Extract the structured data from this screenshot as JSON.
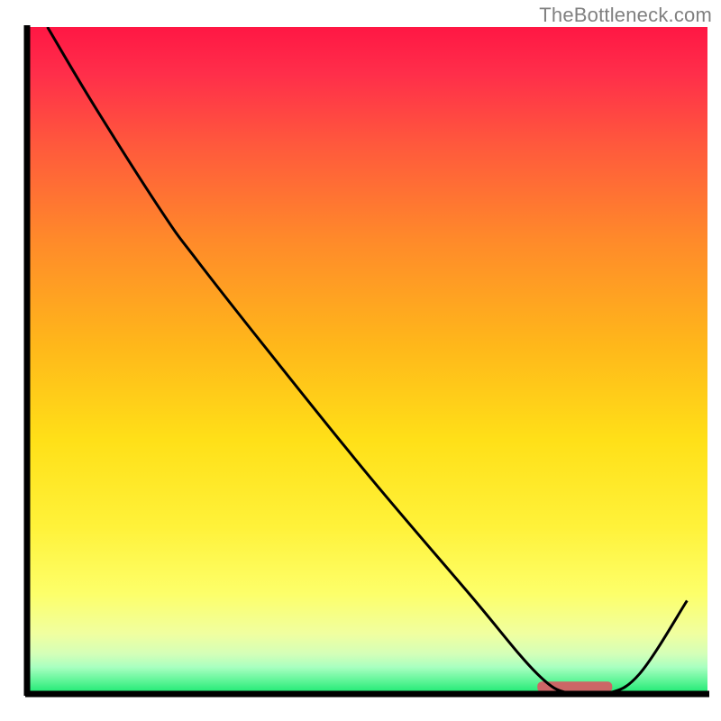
{
  "watermark": "TheBottleneck.com",
  "chart_data": {
    "type": "line",
    "title": "",
    "xlabel": "",
    "ylabel": "",
    "xlim": [
      0,
      100
    ],
    "ylim": [
      0,
      100
    ],
    "x": [
      3,
      10,
      20,
      25,
      35,
      50,
      65,
      75,
      80,
      85,
      90,
      97
    ],
    "values": [
      100,
      88,
      72,
      65,
      52,
      33,
      15,
      3,
      0,
      0,
      3,
      14
    ],
    "optimum_band": {
      "x_start": 75,
      "x_end": 86,
      "y": 0.5
    },
    "background": "rainbow-vertical",
    "axes": {
      "left": true,
      "bottom": true,
      "top": false,
      "right": false
    }
  },
  "colors": {
    "axis": "#000000",
    "curve": "#000000",
    "optimum_marker": "#cc6666",
    "watermark": "#808080"
  }
}
